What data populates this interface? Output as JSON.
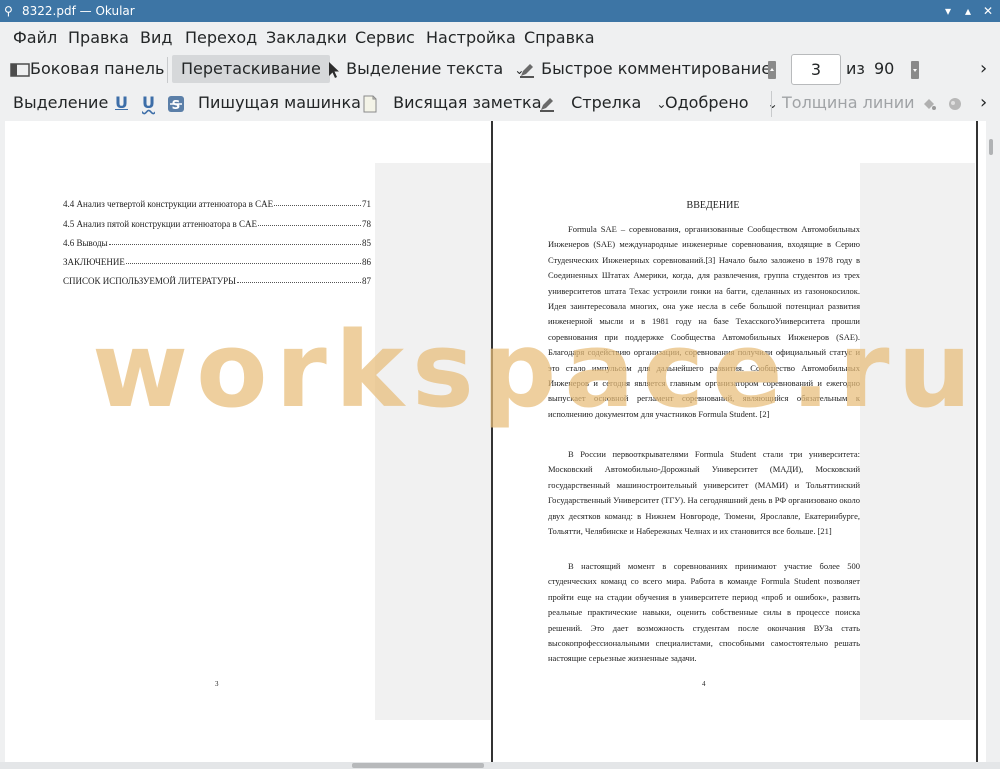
{
  "window": {
    "title": "8322.pdf  — Okular",
    "controls": [
      "▾",
      "▴",
      "✕"
    ]
  },
  "menu": [
    "Файл",
    "Правка",
    "Вид",
    "Переход",
    "Закладки",
    "Сервис",
    "Настройка",
    "Справка"
  ],
  "toolbar1": {
    "sidebar": "Боковая панель",
    "browse": "Перетаскивание",
    "text_select": "Выделение текста",
    "quick_annot": "Быстрое комментирование",
    "page_current": "3",
    "page_of": "из",
    "page_total": "90",
    "overflow": "›"
  },
  "toolbar2": {
    "highlight": "Выделение",
    "typewriter": "Пишущая машинка",
    "popup_note": "Висящая заметка",
    "arrow": "Стрелка",
    "approved": "Одобрено",
    "line_width": "Толщина линии",
    "overflow": "›"
  },
  "left_page": {
    "toc": [
      {
        "title": "4.4 Анализ четвертой конструкции аттенюатора в CAE",
        "page": "71"
      },
      {
        "title": "4.5 Анализ пятой конструкции аттенюатора в CAE",
        "page": "78"
      },
      {
        "title": "4.6 Выводы",
        "page": "85"
      },
      {
        "title": "ЗАКЛЮЧЕНИЕ",
        "page": "86"
      },
      {
        "title": "СПИСОК ИСПОЛЬЗУЕМОЙ ЛИТЕРАТУРЫ",
        "page": "87"
      }
    ],
    "page_number": "3"
  },
  "right_page": {
    "heading": "ВВЕДЕНИЕ",
    "paragraphs": [
      "Formula SAE – соревнования, организованные Сообществом Автомобильных Инженеров (SAE) международные инженерные соревнования, входящие в Серию Студенческих Инженерных соревнований.[3] Начало было заложено в 1978 году в Соединенных Штатах Америки, когда, для развлечения, группа студентов из трех университетов штата Техас устроили гонки на багги, сделанных из газонокосилок. Идея заинтересовала многих, она уже несла в себе большой потенциал развития инженерной мысли и в 1981 году на базе ТехасскогоУниверситета прошли соревнования при поддержке Сообщества Автомобильных Инженеров (SAE). Благодаря содействию организации, соревнования получили официальный статус и это стало импульсом для дальнейшего развития. Сообщество Автомобильных Инженеров и сегодня является главным организатором соревнований и ежегодно выпускает основной регламент соревнований, являющийся обязательным к исполнению документом для участников Formula Student. [2]",
      "В России первооткрывателями Formula Student стали три университета: Московский Автомобильно-Дорожный Университет (МАДИ), Московский государственный машиностроительный университет (МАМИ) и Тольяттинский Государственный Университет (ТГУ). На сегодняшний день в РФ организовано около двух десятков команд: в Нижнем Новгороде, Тюмени, Ярославле, Екатеринбурге, Тольятти, Челябинске и Набережных Челнах и их становится все больше. [21]",
      "В настоящий момент в соревнованиях принимают участие  более 500 студенческих команд со всего мира. Работа в команде Formula Student позволяет пройти еще на стадии обучения в университете период «проб и ошибок», развить реальные практические навыки, оценить собственные силы в процессе поиска решений. Это дает возможность студентам после окончания ВУЗа стать высокопрофессиональными специалистами, способными самостоятельно решать настоящие серьезные жизненные задачи."
    ],
    "page_number": "4"
  },
  "watermark": "workspace.ru",
  "colors": {
    "titlebar": "#3d75a5",
    "watermark": "#e8bc78",
    "active_button": "#d6d8da"
  }
}
